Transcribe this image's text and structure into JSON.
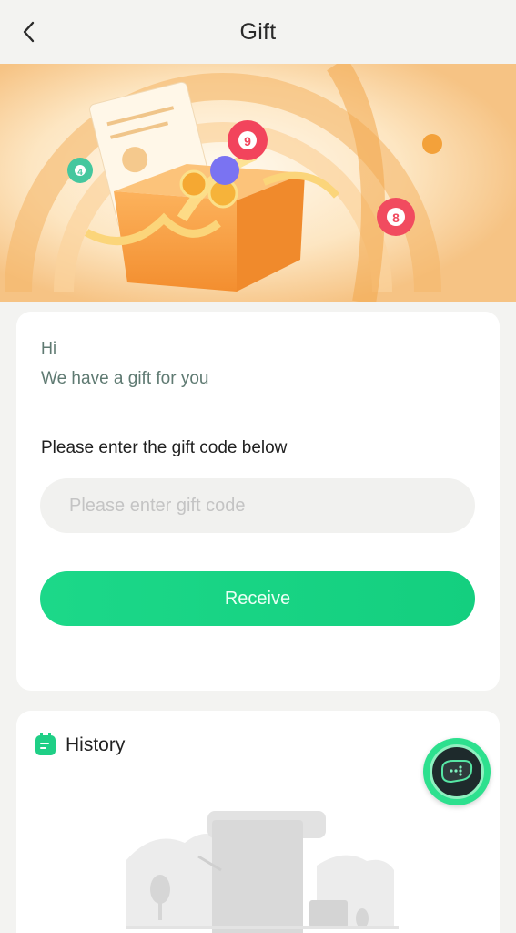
{
  "header": {
    "title": "Gift"
  },
  "gift_card": {
    "greeting": "Hi",
    "message": "We have a gift for you",
    "prompt": "Please enter the gift code below",
    "input_placeholder": "Please enter gift code",
    "input_value": "",
    "receive_label": "Receive"
  },
  "history": {
    "title": "History"
  },
  "banner": {
    "ball_numbers": [
      "4",
      "9",
      "8"
    ]
  },
  "icons": {
    "back": "chevron-left-icon",
    "history": "calendar-note-icon",
    "floating": "chat-bubble-icon"
  },
  "colors": {
    "accent": "#1cd889",
    "background": "#f3f3f1",
    "card": "#ffffff",
    "greeting_text": "#5f7a72"
  }
}
